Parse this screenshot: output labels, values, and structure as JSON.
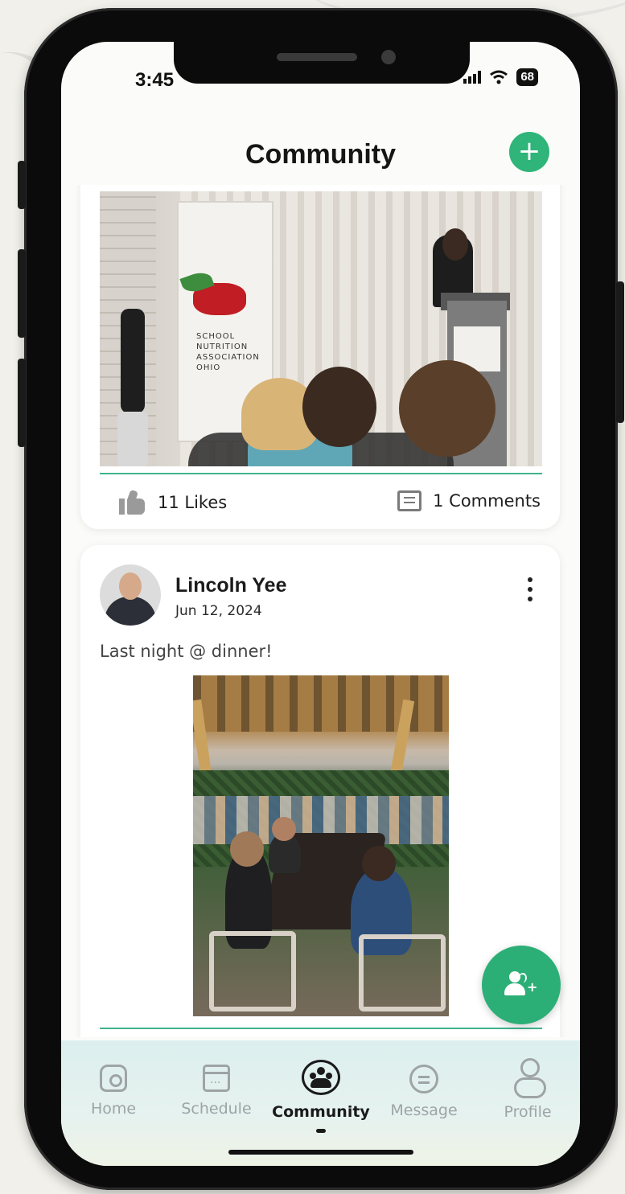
{
  "status_bar": {
    "time": "3:45",
    "battery": "68"
  },
  "header": {
    "title": "Community",
    "add_icon": "plus-icon"
  },
  "posts": [
    {
      "image_description_icon": "event-photo",
      "banner_text": [
        "SCHOOL",
        "NUTRITION",
        "ASSOCIATION",
        "OHIO"
      ],
      "likes_label": "11 Likes",
      "comments_label": "1 Comments"
    },
    {
      "author": "Lincoln Yee",
      "date": "Jun 12, 2024",
      "text": "Last night @ dinner!",
      "image_icon": "dinner-photo"
    }
  ],
  "fab": {
    "icon": "add-user-icon"
  },
  "tabbar": {
    "active": "Community",
    "items": [
      {
        "label": "Home",
        "icon": "home-icon"
      },
      {
        "label": "Schedule",
        "icon": "calendar-icon"
      },
      {
        "label": "Community",
        "icon": "community-icon"
      },
      {
        "label": "Message",
        "icon": "message-icon"
      },
      {
        "label": "Profile",
        "icon": "profile-icon"
      }
    ]
  },
  "colors": {
    "accent": "#2fb47a",
    "divider": "#3fb38b",
    "tabbar_bg": "#dcefee"
  }
}
